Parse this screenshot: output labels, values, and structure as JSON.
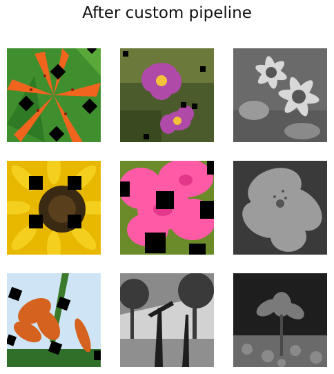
{
  "figure": {
    "title": "After custom pipeline"
  },
  "grid": {
    "rows": 3,
    "cols": 3,
    "tiles": [
      {
        "name": "tile-orange-lily",
        "mode": "color",
        "flower": "spotted orange lily",
        "palette": [
          "#3f8f2f",
          "#f0641e",
          "#1a1a1a"
        ]
      },
      {
        "name": "tile-purple-anemone",
        "mode": "color",
        "flower": "purple anemone",
        "palette": [
          "#4b5b2c",
          "#b04aa8",
          "#f2c23a"
        ]
      },
      {
        "name": "tile-gray-daisies",
        "mode": "grayscale",
        "flower": "daisies",
        "palette": [
          "#6a6a6a",
          "#dcdcdc"
        ]
      },
      {
        "name": "tile-sunflower",
        "mode": "color",
        "flower": "sunflower",
        "palette": [
          "#f2c200",
          "#3a2a14",
          "#1f1f1f"
        ]
      },
      {
        "name": "tile-pink-azalea",
        "mode": "color",
        "flower": "pink azalea",
        "palette": [
          "#ff5aa6",
          "#6b8b2a",
          "#000000"
        ]
      },
      {
        "name": "tile-gray-lily",
        "mode": "grayscale",
        "flower": "lily",
        "palette": [
          "#3a3a3a",
          "#a8a8a8"
        ]
      },
      {
        "name": "tile-tiger-lily-sky",
        "mode": "color",
        "flower": "tiger lily",
        "palette": [
          "#cfe4f4",
          "#d5621f",
          "#2f6f2a"
        ]
      },
      {
        "name": "tile-gray-bird-of-paradise",
        "mode": "grayscale",
        "flower": "bird of paradise",
        "palette": [
          "#cfcfcf",
          "#2c2c2c"
        ]
      },
      {
        "name": "tile-gray-columbine",
        "mode": "grayscale",
        "flower": "columbine",
        "palette": [
          "#5a5a5a",
          "#1a1a1a"
        ]
      }
    ]
  }
}
